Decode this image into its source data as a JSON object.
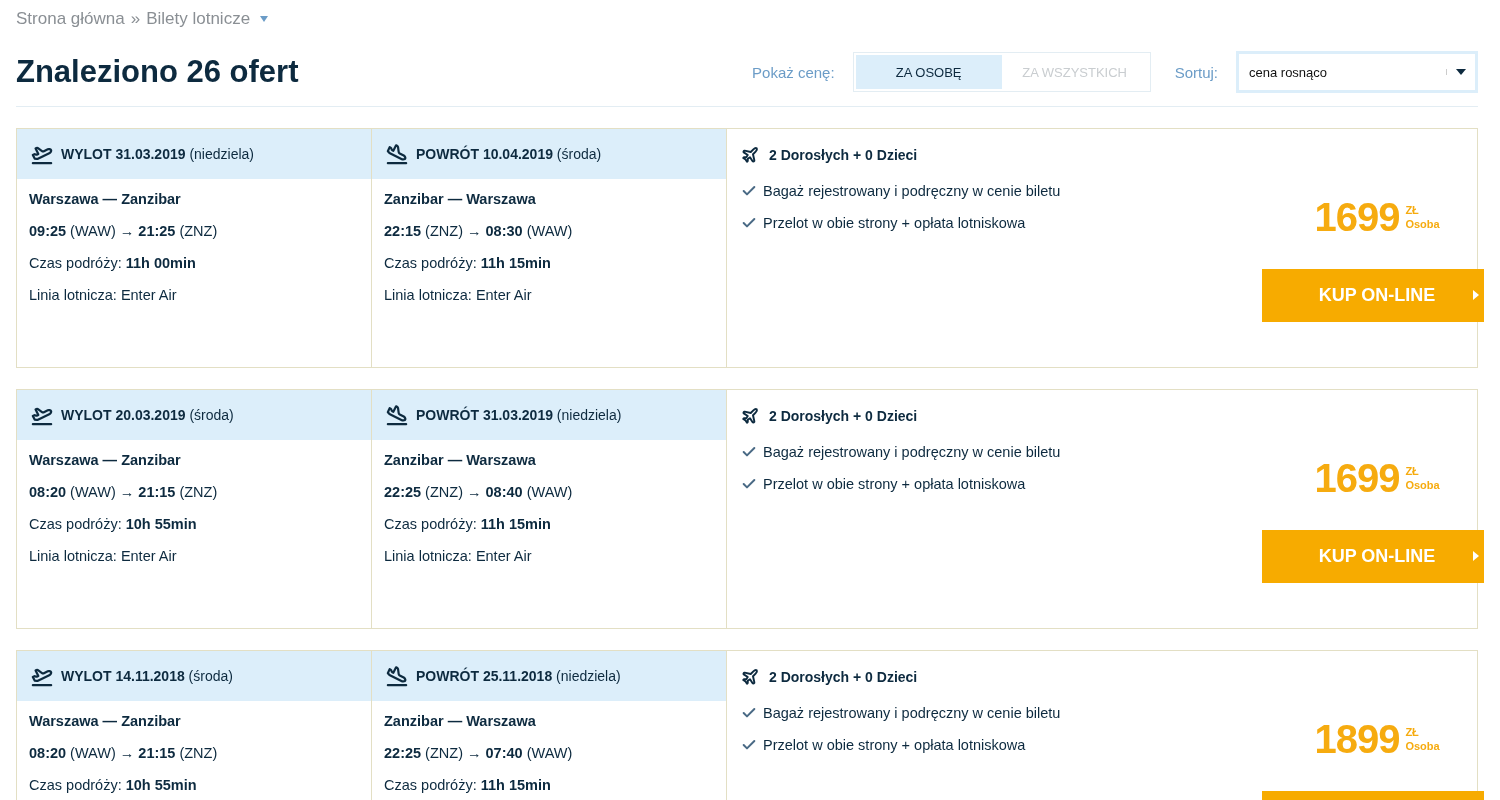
{
  "breadcrumb": {
    "items": [
      "Strona główna",
      "Bilety lotnicze"
    ],
    "separator": "»"
  },
  "title": "Znaleziono 26 ofert",
  "price_toggle": {
    "label": "Pokaż cenę:",
    "options": [
      {
        "label": "ZA OSOBĘ",
        "selected": true
      },
      {
        "label": "ZA WSZYSTKICH",
        "selected": false
      }
    ]
  },
  "sort": {
    "label": "Sortuj:",
    "value": "cena rosnąco"
  },
  "offers": [
    {
      "legs": [
        {
          "kind": "departure",
          "header": "**WYLOT 31.03.2019** (niedziela)",
          "route": "Warszawa — Zanzibar",
          "times": "**09:25** (WAW) → **21:25** (ZNZ)",
          "duration": "Czas podróży: **11h 00min**",
          "airline": "Linia lotnicza: Enter Air"
        },
        {
          "kind": "return",
          "header": "**POWRÓT 10.04.2019** (środa)",
          "route": "Zanzibar — Warszawa",
          "times": "**22:15** (ZNZ) → **08:30** (WAW)",
          "duration": "Czas podróży: **11h 15min**",
          "airline": "Linia lotnicza: Enter Air"
        }
      ],
      "passengers": "2 Dorosłych + 0 Dzieci",
      "features": [
        "Bagaż rejestrowany i podręczny w cenie biletu",
        "Przelot w obie strony + opłata lotniskowa"
      ],
      "price": "1699",
      "currency": "ZŁ",
      "per": "Osoba",
      "button": {
        "label": "KUP ON-LINE"
      }
    },
    {
      "legs": [
        {
          "kind": "departure",
          "header": "**WYLOT 20.03.2019** (środa)",
          "route": "Warszawa — Zanzibar",
          "times": "**08:20** (WAW) → **21:15** (ZNZ)",
          "duration": "Czas podróży: **10h 55min**",
          "airline": "Linia lotnicza: Enter Air"
        },
        {
          "kind": "return",
          "header": "**POWRÓT 31.03.2019** (niedziela)",
          "route": "Zanzibar — Warszawa",
          "times": "**22:25** (ZNZ) → **08:40** (WAW)",
          "duration": "Czas podróży: **11h 15min**",
          "airline": "Linia lotnicza: Enter Air"
        }
      ],
      "passengers": "2 Dorosłych + 0 Dzieci",
      "features": [
        "Bagaż rejestrowany i podręczny w cenie biletu",
        "Przelot w obie strony + opłata lotniskowa"
      ],
      "price": "1699",
      "currency": "ZŁ",
      "per": "Osoba",
      "button": {
        "label": "KUP ON-LINE"
      }
    },
    {
      "legs": [
        {
          "kind": "departure",
          "header": "**WYLOT 14.11.2018** (środa)",
          "route": "Warszawa — Zanzibar",
          "times": "**08:20** (WAW) → **21:15** (ZNZ)",
          "duration": "Czas podróży: **10h 55min**"
        },
        {
          "kind": "return",
          "header": "**POWRÓT 25.11.2018** (niedziela)",
          "route": "Zanzibar — Warszawa",
          "times": "**22:25** (ZNZ) → **07:40** (WAW)",
          "duration": "Czas podróży: **11h 15min**"
        }
      ],
      "passengers": "2 Dorosłych + 0 Dzieci",
      "features": [
        "Bagaż rejestrowany i podręczny w cenie biletu",
        "Przelot w obie strony + opłata lotniskowa"
      ],
      "price": "1899",
      "currency": "ZŁ",
      "per": "Osoba"
    }
  ]
}
